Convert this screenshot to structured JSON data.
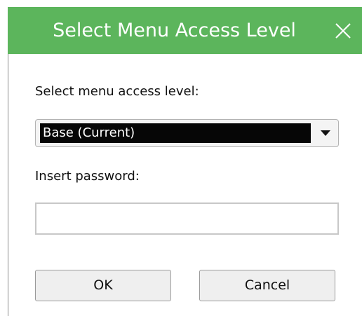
{
  "dialog": {
    "title": "Select Menu Access Level",
    "close_icon": "close-icon",
    "accent_color": "#5cb55c"
  },
  "access_level": {
    "label": "Select menu access level:",
    "selected_value": "Base (Current)",
    "dropdown_icon": "chevron-down-icon"
  },
  "password": {
    "label": "Insert password:",
    "value": "",
    "placeholder": ""
  },
  "buttons": {
    "ok_label": "OK",
    "cancel_label": "Cancel"
  }
}
